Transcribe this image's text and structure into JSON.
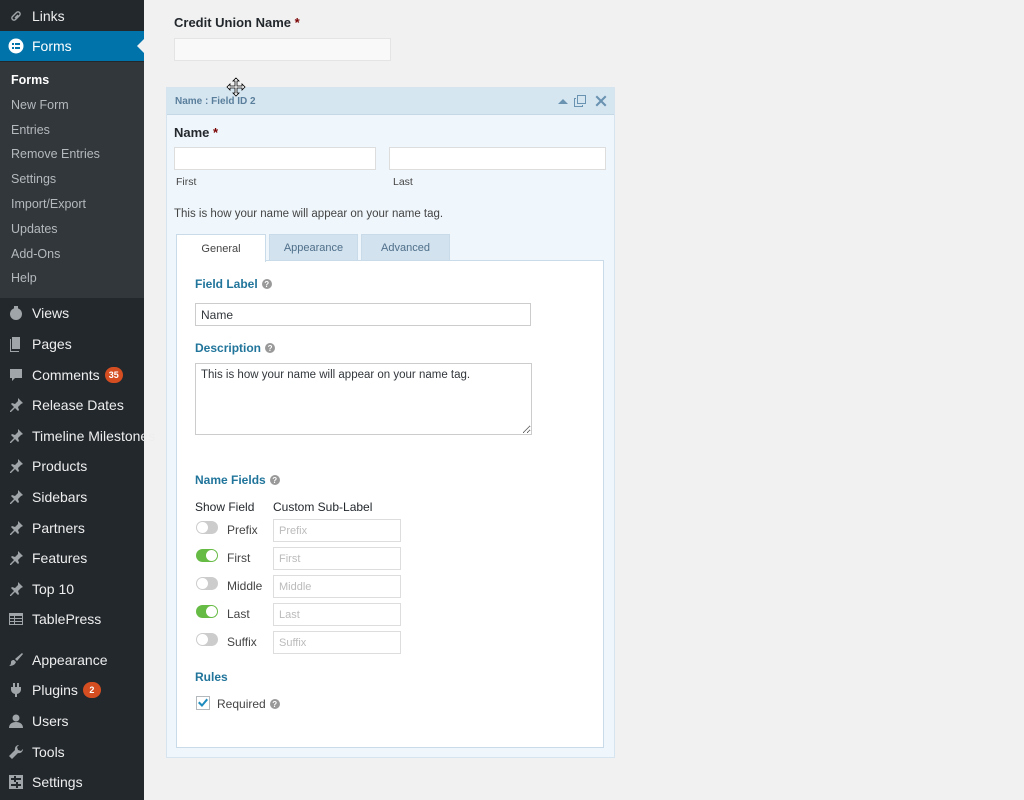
{
  "sidebar": {
    "top_items": [
      {
        "label": "Links",
        "icon": "link-icon"
      },
      {
        "label": "Forms",
        "icon": "forms-icon"
      }
    ],
    "forms_submenu": [
      "Forms",
      "New Form",
      "Entries",
      "Remove Entries",
      "Settings",
      "Import/Export",
      "Updates",
      "Add-Ons",
      "Help"
    ],
    "items": [
      {
        "label": "Views",
        "icon": "views-icon"
      },
      {
        "label": "Pages",
        "icon": "pages-icon"
      },
      {
        "label": "Comments",
        "icon": "comments-icon",
        "badge": "35"
      },
      {
        "label": "Release Dates",
        "icon": "pin-icon"
      },
      {
        "label": "Timeline Milestones",
        "icon": "pin-icon"
      },
      {
        "label": "Products",
        "icon": "pin-icon"
      },
      {
        "label": "Sidebars",
        "icon": "pin-icon"
      },
      {
        "label": "Partners",
        "icon": "pin-icon"
      },
      {
        "label": "Features",
        "icon": "pin-icon"
      },
      {
        "label": "Top 10",
        "icon": "pin-icon"
      },
      {
        "label": "TablePress",
        "icon": "table-icon"
      },
      {
        "label": "Appearance",
        "icon": "brush-icon"
      },
      {
        "label": "Plugins",
        "icon": "plugin-icon",
        "badge": "2"
      },
      {
        "label": "Users",
        "icon": "user-icon"
      },
      {
        "label": "Tools",
        "icon": "wrench-icon"
      },
      {
        "label": "Settings",
        "icon": "settings-icon"
      }
    ],
    "badge_color": "#d54e21",
    "active_color": "#0073aa"
  },
  "form": {
    "credit_union_label": "Credit Union Name",
    "required_mark": "*"
  },
  "field_panel": {
    "title": "Name : Field ID 2",
    "name_label": "Name",
    "required_mark": "*",
    "first_sublabel": "First",
    "last_sublabel": "Last",
    "description": "This is how your name will appear on your name tag.",
    "tabs": [
      "General",
      "Appearance",
      "Advanced"
    ],
    "active_tab": "General"
  },
  "settings": {
    "field_label_heading": "Field Label",
    "field_label_value": "Name",
    "description_heading": "Description",
    "description_value": "This is how your name will appear on your name tag.",
    "name_fields_heading": "Name Fields",
    "show_field_col": "Show Field",
    "custom_sublabel_col": "Custom Sub-Label",
    "name_fields": [
      {
        "label": "Prefix",
        "enabled": false,
        "placeholder": "Prefix"
      },
      {
        "label": "First",
        "enabled": true,
        "placeholder": "First"
      },
      {
        "label": "Middle",
        "enabled": false,
        "placeholder": "Middle"
      },
      {
        "label": "Last",
        "enabled": true,
        "placeholder": "Last"
      },
      {
        "label": "Suffix",
        "enabled": false,
        "placeholder": "Suffix"
      }
    ],
    "rules_heading": "Rules",
    "required_label": "Required",
    "required_checked": true,
    "toggle_on_color": "#66bb44"
  }
}
